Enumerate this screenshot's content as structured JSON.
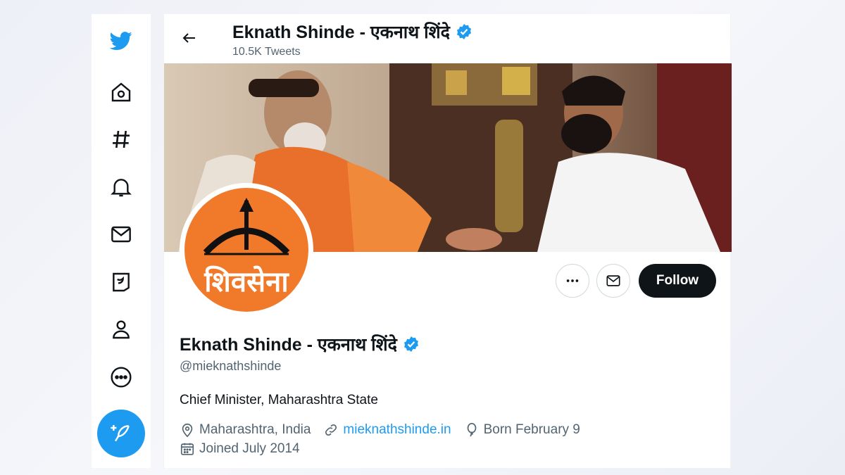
{
  "colors": {
    "accent": "#1d9bf0",
    "verified": "#1d9bf0",
    "text": "#0f1419",
    "secondary": "#536471",
    "avatar_bg": "#f07a2a"
  },
  "sidebar": {
    "items": [
      {
        "icon": "twitter-logo-icon"
      },
      {
        "icon": "home-icon"
      },
      {
        "icon": "hashtag-icon"
      },
      {
        "icon": "bell-icon"
      },
      {
        "icon": "mail-icon"
      },
      {
        "icon": "twitter-blue-icon"
      },
      {
        "icon": "profile-icon"
      },
      {
        "icon": "more-circle-icon"
      }
    ],
    "compose_icon": "compose-feather-icon"
  },
  "header": {
    "name": "Eknath Shinde - एकनाथ शिंदे",
    "tweet_count": "10.5K Tweets"
  },
  "profile": {
    "avatar_text": "शिवसेना",
    "name": "Eknath Shinde - एकनाथ शिंदे",
    "handle": "@mieknathshinde",
    "bio": "Chief Minister, Maharashtra State",
    "location": "Maharashtra, India",
    "website": "mieknathshinde.in",
    "birthday": "Born February 9",
    "joined": "Joined July 2014",
    "follow_label": "Follow"
  }
}
